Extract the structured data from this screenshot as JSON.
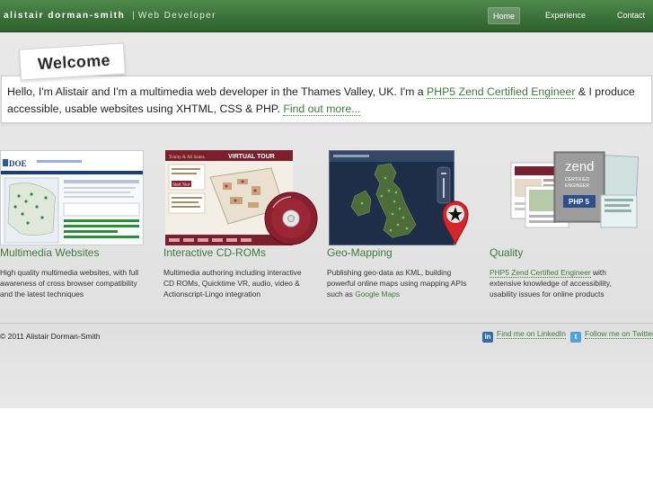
{
  "header": {
    "brand_name": "alistair dorman-smith",
    "separator": "|",
    "brand_tagline": "Web Developer",
    "nav": [
      {
        "label": "Home",
        "active": true
      },
      {
        "label": "Experience",
        "active": false
      },
      {
        "label": "Contact",
        "active": false
      }
    ]
  },
  "welcome": {
    "title": "Welcome",
    "intro_part1": "Hello, I'm Alistair and I'm a multimedia web developer in the Thames Valley, UK. I'm a ",
    "zend_link": "PHP5 Zend Certified Engineer",
    "intro_part2": " & I produce accessible, usable websites using XHTML, CSS & PHP. ",
    "find_out_link": "Find out more..."
  },
  "columns": [
    {
      "title": "Multimedia Websites",
      "description": "High quality multimedia websites, with full awareness of cross browser compatibility and the latest techniques",
      "thumb_caption": "DOE"
    },
    {
      "title": "Interactive CD-ROMs",
      "description": "Multimedia authoring including interactive CD ROMs, Quicktime VR, audio, video & Actionscript-Lingo integration",
      "thumb_caption": "VIRTUAL TOUR",
      "thumb_caption2": "Trinity & All Saints",
      "thumb_caption3": "Start Tour"
    },
    {
      "title": "Geo-Mapping",
      "description_part1": "Publishing geo-data as KML, building powerful online maps using mapping APIs such as ",
      "description_link": "Google Maps"
    },
    {
      "title": "Quality",
      "description_link": "PHP5 Zend Certified Engineer",
      "description_part2": " with extensive knowledge of accessibility, usability issues for online products",
      "badge_line1": "zend",
      "badge_line2": "CERTIFIED",
      "badge_line3": "ENGINEER",
      "badge_line4": "PHP 5"
    }
  ],
  "footer": {
    "copyright": "© 2011 Alistair Dorman-Smith",
    "linkedin": "Find me on LinkedIn",
    "twitter": "Follow me on Twitter"
  },
  "colors": {
    "header_green": "#3b7139",
    "link_green": "#3e7a3c",
    "background_grey": "#e4e4e4"
  },
  "icons": [
    "linkedin-icon",
    "twitter-icon",
    "map-pin-icon"
  ]
}
